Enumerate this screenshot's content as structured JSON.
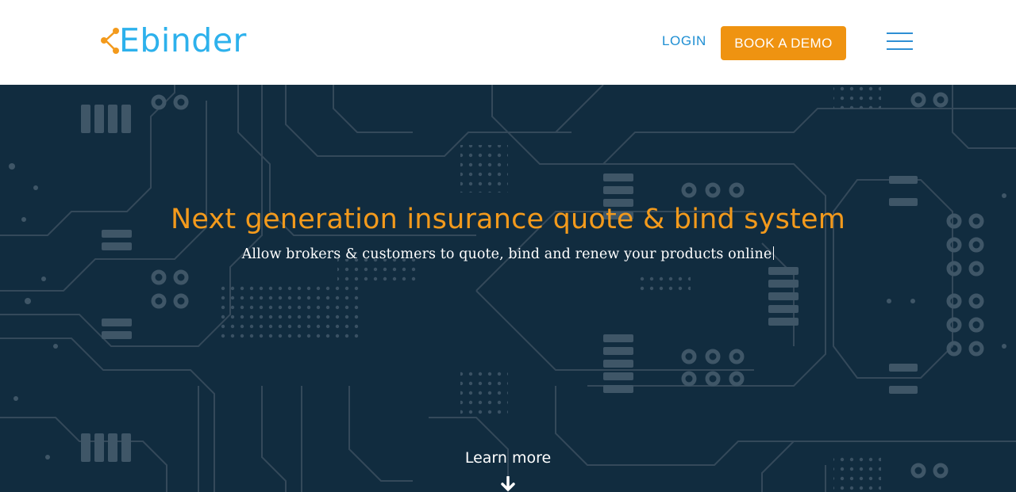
{
  "header": {
    "logo_text": "Ebinder",
    "logo_icon": "logo-nodes-icon",
    "login_label": "LOGIN",
    "demo_label": "BOOK A DEMO",
    "menu_icon": "hamburger-menu-icon"
  },
  "hero": {
    "title": "Next generation insurance quote & bind system",
    "subtitle": "Allow brokers & customers to quote, bind and renew your products online",
    "learn_more": "Learn more",
    "arrow_icon": "arrow-down-icon"
  },
  "colors": {
    "brand_blue": "#2db1ec",
    "accent_orange": "#ef9311",
    "title_orange": "#f39a1c",
    "hero_bg": "#112c3f",
    "nav_blue": "#1f8fd3"
  }
}
